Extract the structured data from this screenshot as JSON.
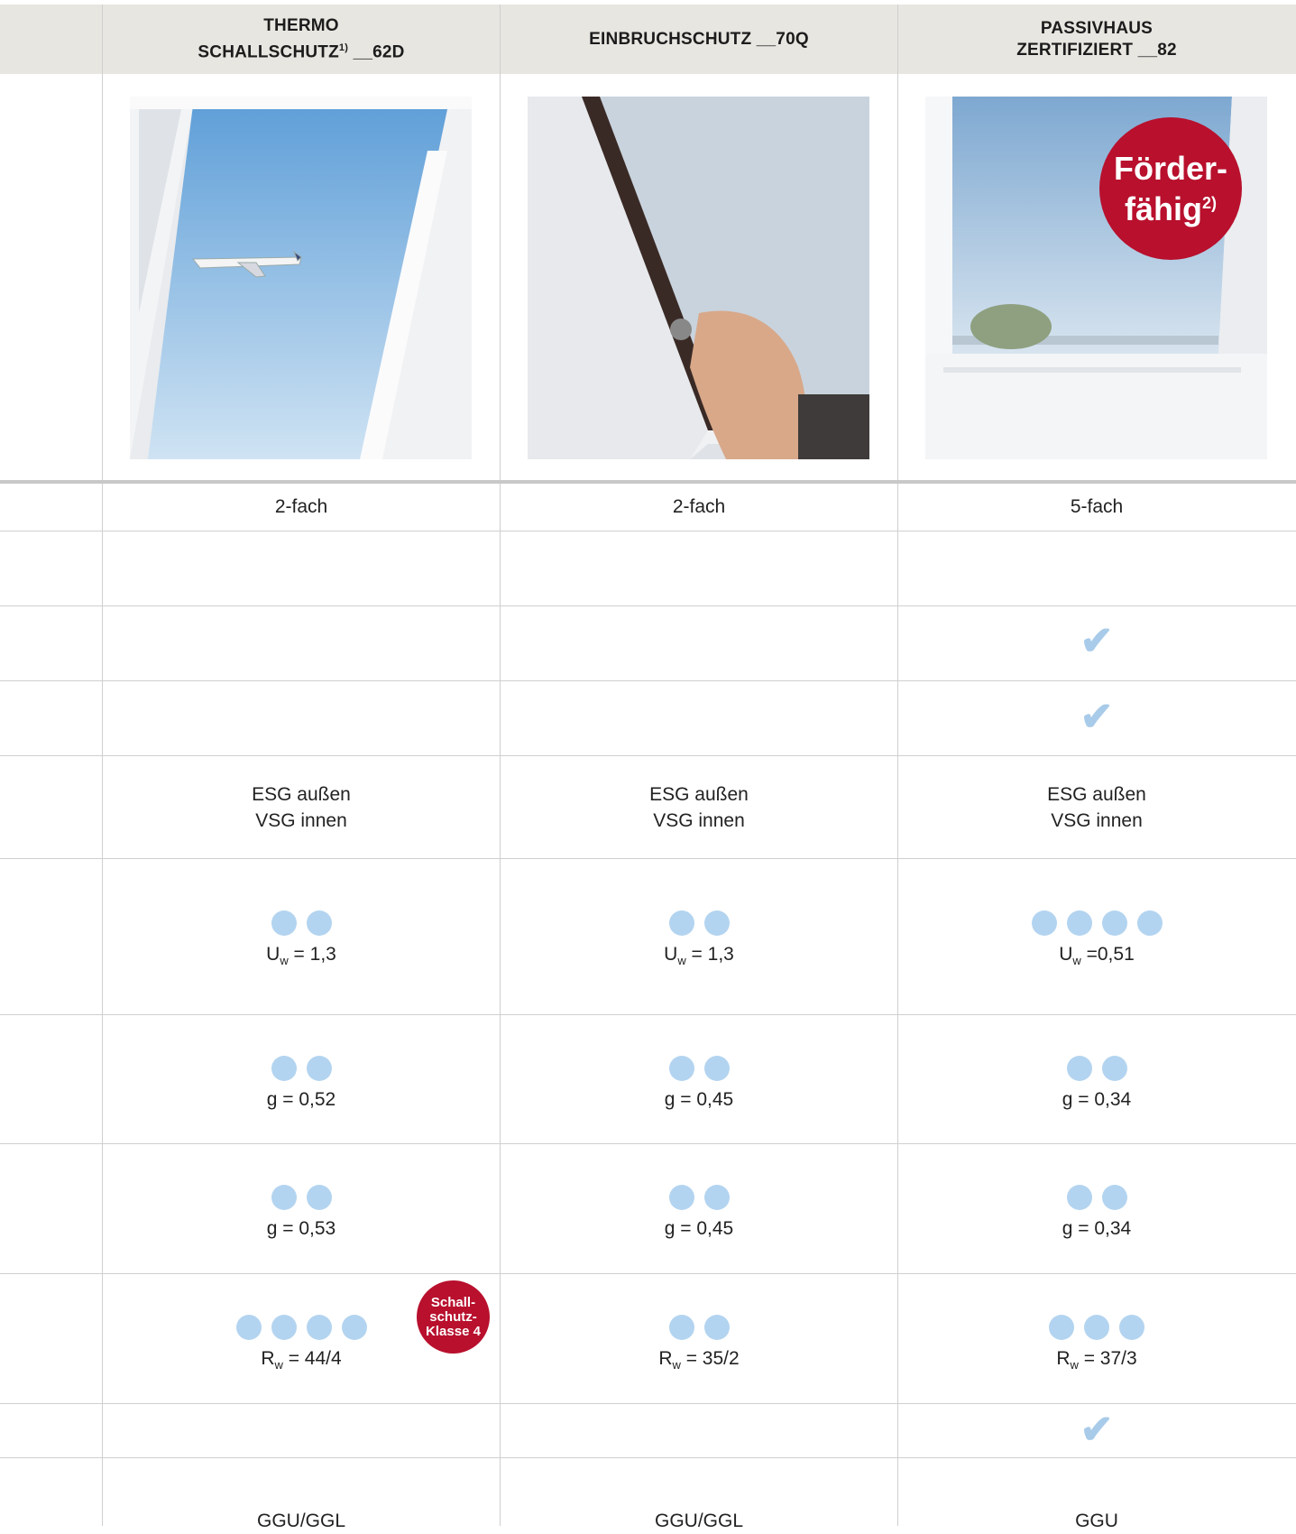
{
  "columns": [
    {
      "title_line1": "THERMO",
      "title_line2": "SCHALLSCHUTZ",
      "title_sup": "1)",
      "title_suffix": " __62D"
    },
    {
      "title_line1": "EINBRUCHSCHUTZ __70Q"
    },
    {
      "title_line1": "PASSIVHAUS",
      "title_line2": "ZERTIFIZIERT __82"
    }
  ],
  "rows": {
    "fach": [
      "2-fach",
      "2-fach",
      "5-fach"
    ],
    "glass_line1": [
      "ESG außen",
      "ESG außen",
      "ESG außen"
    ],
    "glass_line2": [
      "VSG innen",
      "VSG innen",
      "VSG innen"
    ],
    "uw": [
      {
        "dots": 2,
        "sym": "U",
        "sub": "w",
        "value": " = 1,3"
      },
      {
        "dots": 2,
        "sym": "U",
        "sub": "w",
        "value": " = 1,3"
      },
      {
        "dots": 4,
        "sym": "U",
        "sub": "w",
        "value": " =0,51"
      }
    ],
    "g1": [
      {
        "dots": 2,
        "value": "g = 0,52"
      },
      {
        "dots": 2,
        "value": "g = 0,45"
      },
      {
        "dots": 2,
        "value": "g = 0,34"
      }
    ],
    "g2": [
      {
        "dots": 2,
        "value": "g = 0,53"
      },
      {
        "dots": 2,
        "value": "g = 0,45"
      },
      {
        "dots": 2,
        "value": "g = 0,34"
      }
    ],
    "rw": [
      {
        "dots": 4,
        "sym": "R",
        "sub": "w",
        "value": " = 44/4"
      },
      {
        "dots": 2,
        "sym": "R",
        "sub": "w",
        "value": " = 35/2"
      },
      {
        "dots": 3,
        "sym": "R",
        "sub": "w",
        "value": " = 37/3"
      }
    ],
    "type": [
      "GGU/GGL",
      "GGU/GGL",
      "GGU"
    ]
  },
  "check_symbol": "✔",
  "badge_schallschutz": {
    "line1": "Schall-",
    "line2": "schutz-",
    "line3": "Klasse 4"
  },
  "badge_foerder": {
    "line1": "Förder-",
    "line2": "fähig",
    "sup": "2)"
  },
  "colors": {
    "accent_red": "#b8102d",
    "dot_blue": "#b3d4f0",
    "header_bg": "#e8e6e1"
  }
}
